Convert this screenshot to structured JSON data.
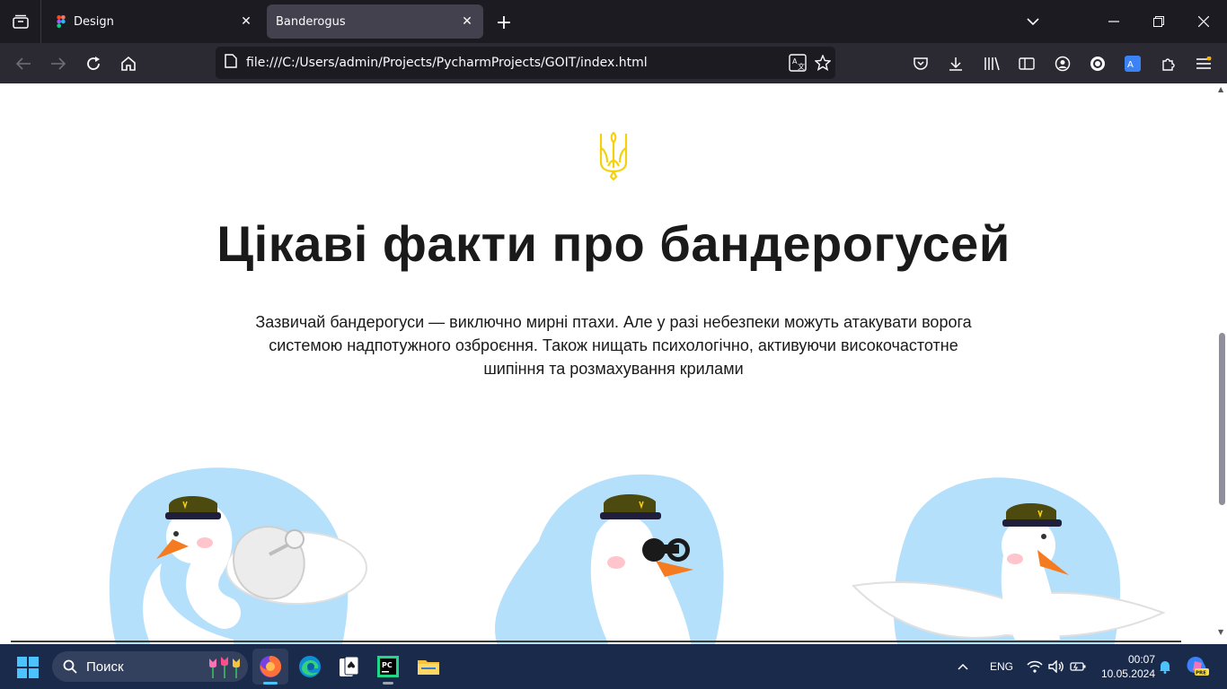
{
  "browser": {
    "tabs": [
      {
        "title": "Design",
        "favicon": "figma-icon"
      },
      {
        "title": "Banderogus",
        "favicon": "none",
        "active": true
      }
    ],
    "url": "file:///C:/Users/admin/Projects/PycharmProjects/GOIT/index.html"
  },
  "page": {
    "heading": "Цікаві факти про бандерогусей",
    "description": "Зазвичай бандерогуси — виключно мирні птахи. Але у разі небезпеки можуть атакувати ворога системою надпотужного озброєння. Також нищать психологічно, активуючи високочастотне шипіння та розмахування крилами",
    "accent_color": "#f5d10c",
    "blob_color": "#b5e0fb",
    "geese": [
      {
        "name": "goose-with-radar",
        "prop": "satellite-dish"
      },
      {
        "name": "goose-with-binoculars",
        "prop": "binoculars"
      },
      {
        "name": "goose-spreading-wings",
        "prop": "wings"
      }
    ]
  },
  "taskbar": {
    "search_label": "Поиск",
    "language": "ENG",
    "time": "00:07",
    "date": "10.05.2024"
  }
}
